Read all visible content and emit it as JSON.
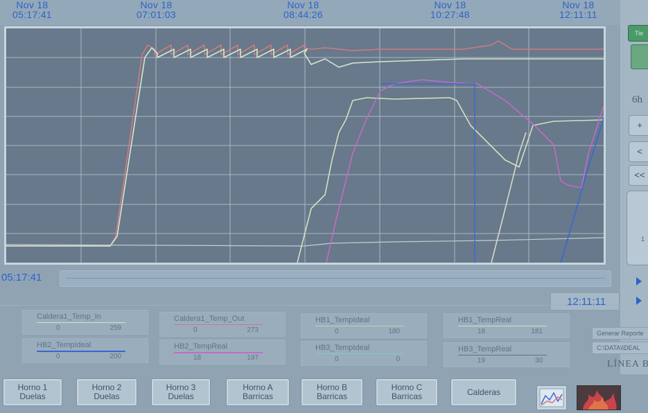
{
  "timeline": {
    "labels": [
      {
        "date": "Nov 18",
        "time": "05:17:41"
      },
      {
        "date": "Nov 18",
        "time": "07:01:03"
      },
      {
        "date": "Nov 18",
        "time": "08:44:26"
      },
      {
        "date": "Nov 18",
        "time": "10:27:48"
      },
      {
        "date": "Nov 18",
        "time": "12:11:11"
      }
    ],
    "start_time": "05:17:41",
    "end_time": "12:11:11"
  },
  "right_panel": {
    "mode_button_label": "Tie",
    "range_label": "6h",
    "zoom_in_label": "+",
    "back_label": "<",
    "rewind_label": "<<",
    "knob_tick_label": "1"
  },
  "colors": {
    "caldera_in": "#d7e8cf",
    "caldera_out": "#d07a84",
    "hb1_ideal": "#b8d6a8",
    "hb1_real": "#d7dfc0",
    "hb2_ideal": "#3a66d6",
    "hb2_real": "#c46bc6",
    "hb3_ideal": "#d8dac8",
    "hb3_real": "#d5dcd8"
  },
  "legend": [
    {
      "name": "Caldera1_Temp_In",
      "min": "0",
      "max": "259",
      "color": "#cfe3c8"
    },
    {
      "name": "Caldera1_Temp_Out",
      "min": "0",
      "max": "273",
      "color": "#d07a84"
    },
    {
      "name": "HB1_TempIdeal",
      "min": "0",
      "max": "180",
      "color": "#b8d6a8"
    },
    {
      "name": "HB1_TempReal",
      "min": "18",
      "max": "181",
      "color": "#d7dfc0"
    },
    {
      "name": "HB2_TempIdeal",
      "min": "0",
      "max": "200",
      "color": "#3a66d6"
    },
    {
      "name": "HB2_TempReal",
      "min": "18",
      "max": "197",
      "color": "#c46bc6"
    },
    {
      "name": "HB3_TempIdeal",
      "min": "0",
      "max": "0",
      "color": "#88c9c0"
    },
    {
      "name": "HB3_TempReal",
      "min": "19",
      "max": "30",
      "color": "#d8d8d8"
    }
  ],
  "report": {
    "button_label": "Generar Reporte",
    "path": "C:\\DATA\\IDEAL"
  },
  "brand": "LÍNEA B",
  "nav": [
    {
      "line1": "Horno 1",
      "line2": "Duelas"
    },
    {
      "line1": "Horno 2",
      "line2": "Duelas"
    },
    {
      "line1": "Horno 3",
      "line2": "Duelas"
    },
    {
      "line1": "Horno A",
      "line2": "Barricas"
    },
    {
      "line1": "Horno B",
      "line2": "Barricas"
    },
    {
      "line1": "Horno C",
      "line2": "Barricas"
    },
    {
      "line1": "Calderas",
      "line2": ""
    }
  ]
}
